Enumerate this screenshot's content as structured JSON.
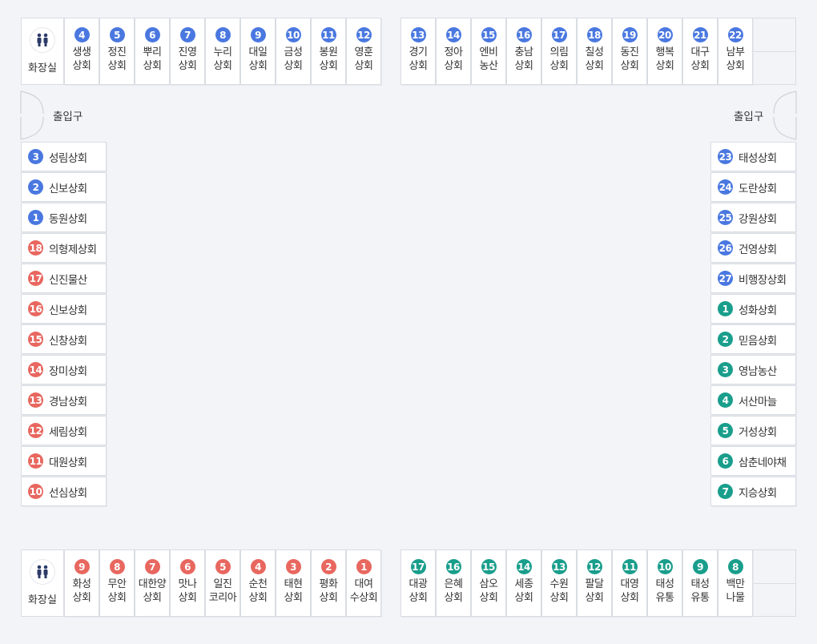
{
  "restrooms": {
    "label": "화장실"
  },
  "entrances": {
    "left": "출입구",
    "right": "출입구"
  },
  "colors": {
    "blue": "#4a78e0",
    "red": "#e8675f",
    "teal": "#1a9e8c"
  },
  "top_left": [
    {
      "num": "4",
      "name": "생생\n상회",
      "color": "blue"
    },
    {
      "num": "5",
      "name": "정진\n상회",
      "color": "blue"
    },
    {
      "num": "6",
      "name": "뿌리\n상회",
      "color": "blue"
    },
    {
      "num": "7",
      "name": "진영\n상회",
      "color": "blue"
    },
    {
      "num": "8",
      "name": "누리\n상회",
      "color": "blue"
    },
    {
      "num": "9",
      "name": "대일\n상회",
      "color": "blue"
    },
    {
      "num": "10",
      "name": "금성\n상회",
      "color": "blue"
    },
    {
      "num": "11",
      "name": "봉원\n상회",
      "color": "blue"
    },
    {
      "num": "12",
      "name": "영훈\n상회",
      "color": "blue"
    }
  ],
  "top_right": [
    {
      "num": "13",
      "name": "경기\n상회",
      "color": "blue"
    },
    {
      "num": "14",
      "name": "정아\n상회",
      "color": "blue"
    },
    {
      "num": "15",
      "name": "엔비\n농산",
      "color": "blue"
    },
    {
      "num": "16",
      "name": "충남\n상회",
      "color": "blue"
    },
    {
      "num": "17",
      "name": "의림\n상회",
      "color": "blue"
    },
    {
      "num": "18",
      "name": "칠성\n상회",
      "color": "blue"
    },
    {
      "num": "19",
      "name": "동진\n상회",
      "color": "blue"
    },
    {
      "num": "20",
      "name": "행복\n상회",
      "color": "blue"
    },
    {
      "num": "21",
      "name": "대구\n상회",
      "color": "blue"
    },
    {
      "num": "22",
      "name": "남부\n상회",
      "color": "blue"
    }
  ],
  "left_column": [
    {
      "num": "3",
      "name": "성림상회",
      "color": "blue"
    },
    {
      "num": "2",
      "name": "신보상회",
      "color": "blue"
    },
    {
      "num": "1",
      "name": "동원상회",
      "color": "blue"
    },
    {
      "num": "18",
      "name": "의형제상회",
      "color": "red"
    },
    {
      "num": "17",
      "name": "신진물산",
      "color": "red"
    },
    {
      "num": "16",
      "name": "신보상회",
      "color": "red"
    },
    {
      "num": "15",
      "name": "신창상회",
      "color": "red"
    },
    {
      "num": "14",
      "name": "장미상회",
      "color": "red"
    },
    {
      "num": "13",
      "name": "경남상회",
      "color": "red"
    },
    {
      "num": "12",
      "name": "세림상회",
      "color": "red"
    },
    {
      "num": "11",
      "name": "대원상회",
      "color": "red"
    },
    {
      "num": "10",
      "name": "선심상회",
      "color": "red"
    }
  ],
  "right_column": [
    {
      "num": "23",
      "name": "태성상회",
      "color": "blue"
    },
    {
      "num": "24",
      "name": "도란상회",
      "color": "blue"
    },
    {
      "num": "25",
      "name": "강원상회",
      "color": "blue"
    },
    {
      "num": "26",
      "name": "건영상회",
      "color": "blue"
    },
    {
      "num": "27",
      "name": "비행장상회",
      "color": "blue"
    },
    {
      "num": "1",
      "name": "성화상회",
      "color": "teal"
    },
    {
      "num": "2",
      "name": "믿음상회",
      "color": "teal"
    },
    {
      "num": "3",
      "name": "영남농산",
      "color": "teal"
    },
    {
      "num": "4",
      "name": "서산마늘",
      "color": "teal"
    },
    {
      "num": "5",
      "name": "거성상회",
      "color": "teal"
    },
    {
      "num": "6",
      "name": "삼춘네야채",
      "color": "teal"
    },
    {
      "num": "7",
      "name": "지승상회",
      "color": "teal"
    }
  ],
  "bottom_left": [
    {
      "num": "9",
      "name": "화성\n상회",
      "color": "red"
    },
    {
      "num": "8",
      "name": "무안\n상회",
      "color": "red"
    },
    {
      "num": "7",
      "name": "대한양\n상회",
      "color": "red"
    },
    {
      "num": "6",
      "name": "맛나\n상회",
      "color": "red"
    },
    {
      "num": "5",
      "name": "일진\n코리아",
      "color": "red"
    },
    {
      "num": "4",
      "name": "순천\n상회",
      "color": "red"
    },
    {
      "num": "3",
      "name": "태현\n상회",
      "color": "red"
    },
    {
      "num": "2",
      "name": "평화\n상회",
      "color": "red"
    },
    {
      "num": "1",
      "name": "대여\n수상회",
      "color": "red"
    }
  ],
  "bottom_right": [
    {
      "num": "17",
      "name": "대광\n상회",
      "color": "teal"
    },
    {
      "num": "16",
      "name": "은혜\n상회",
      "color": "teal"
    },
    {
      "num": "15",
      "name": "삼오\n상회",
      "color": "teal"
    },
    {
      "num": "14",
      "name": "세종\n상회",
      "color": "teal"
    },
    {
      "num": "13",
      "name": "수원\n상회",
      "color": "teal"
    },
    {
      "num": "12",
      "name": "팔달\n상회",
      "color": "teal"
    },
    {
      "num": "11",
      "name": "대영\n상회",
      "color": "teal"
    },
    {
      "num": "10",
      "name": "태성\n유통",
      "color": "teal"
    },
    {
      "num": "9",
      "name": "태성\n유통",
      "color": "teal"
    },
    {
      "num": "8",
      "name": "백만\n나물",
      "color": "teal"
    }
  ]
}
